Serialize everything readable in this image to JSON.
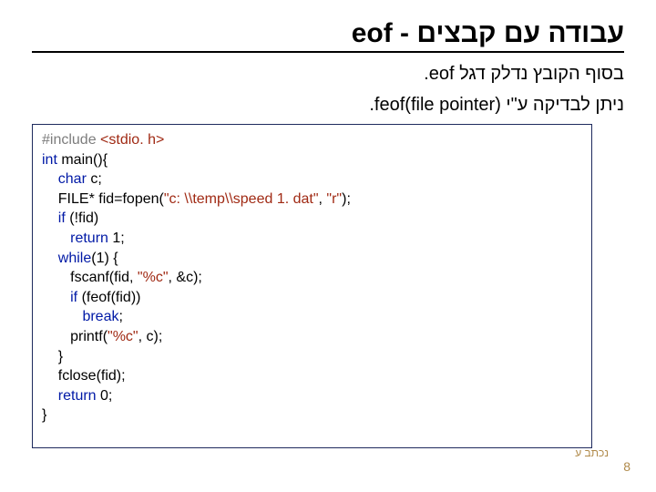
{
  "title": "עבודה עם קבצים - eof",
  "desc_line1": "בסוף הקובץ נדלק דגל eof.",
  "desc_line2": "ניתן לבדיקה ע\"י (feof(file pointer.",
  "code": {
    "l1_a": "#include ",
    "l1_b": "<stdio. h>",
    "l2_a": "int",
    "l2_b": " main(){",
    "l3_a": "    ",
    "l3_b": "char ",
    "l3_c": "c;",
    "l4_a": "    FILE* fid=fopen(",
    "l4_b": "\"c: \\\\temp\\\\speed 1. dat\"",
    "l4_c": ", ",
    "l4_d": "\"r\"",
    "l4_e": ");",
    "l5_a": "    ",
    "l5_b": "if ",
    "l5_c": "(!fid)",
    "l6_a": "       ",
    "l6_b": "return ",
    "l6_c": "1;",
    "l7_a": "    ",
    "l7_b": "while",
    "l7_c": "(1) {",
    "l8_a": "       fscanf(fid, ",
    "l8_b": "\"%c\"",
    "l8_c": ", &c);",
    "l9_a": "       ",
    "l9_b": "if ",
    "l9_c": "(feof(fid))",
    "l10_a": "          ",
    "l10_b": "break",
    "l10_c": ";",
    "l11_a": "       printf(",
    "l11_b": "\"%c\"",
    "l11_c": ", c);",
    "l12": "    }",
    "l13": "    fclose(fid);",
    "l14_a": "    ",
    "l14_b": "return ",
    "l14_c": "0;",
    "l15": "}"
  },
  "page_num": "8",
  "credit": "נכתב ע"
}
